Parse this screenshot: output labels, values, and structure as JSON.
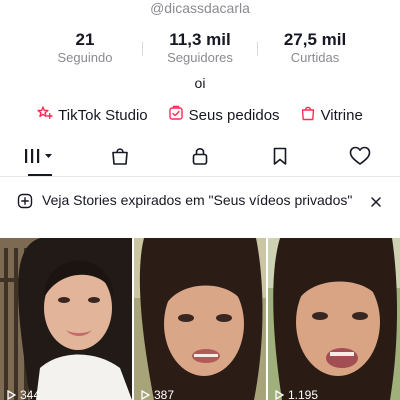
{
  "profile": {
    "username": "@dicassdacarla",
    "bio": "oi"
  },
  "stats": [
    {
      "value": "21",
      "label": "Seguindo"
    },
    {
      "value": "11,3 mil",
      "label": "Seguidores"
    },
    {
      "value": "27,5 mil",
      "label": "Curtidas"
    }
  ],
  "links": [
    {
      "label": "TikTok Studio",
      "icon": "tiktok-studio-icon"
    },
    {
      "label": "Seus pedidos",
      "icon": "orders-icon"
    },
    {
      "label": "Vitrine",
      "icon": "shopping-bag-icon"
    }
  ],
  "tabs": [
    {
      "name": "videos",
      "icon": "grid-icon",
      "active": true
    },
    {
      "name": "shop",
      "icon": "bag-icon"
    },
    {
      "name": "private",
      "icon": "lock-icon"
    },
    {
      "name": "saved",
      "icon": "bookmark-icon"
    },
    {
      "name": "liked",
      "icon": "heart-icon"
    }
  ],
  "notice": {
    "text": "Veja Stories expirados em \"Seus vídeos privados\""
  },
  "videos": [
    {
      "views": "344"
    },
    {
      "views": "387"
    },
    {
      "views": "1.195"
    }
  ],
  "colors": {
    "accent": "#fe2c55",
    "text": "#161823",
    "muted": "#8a8b91"
  }
}
